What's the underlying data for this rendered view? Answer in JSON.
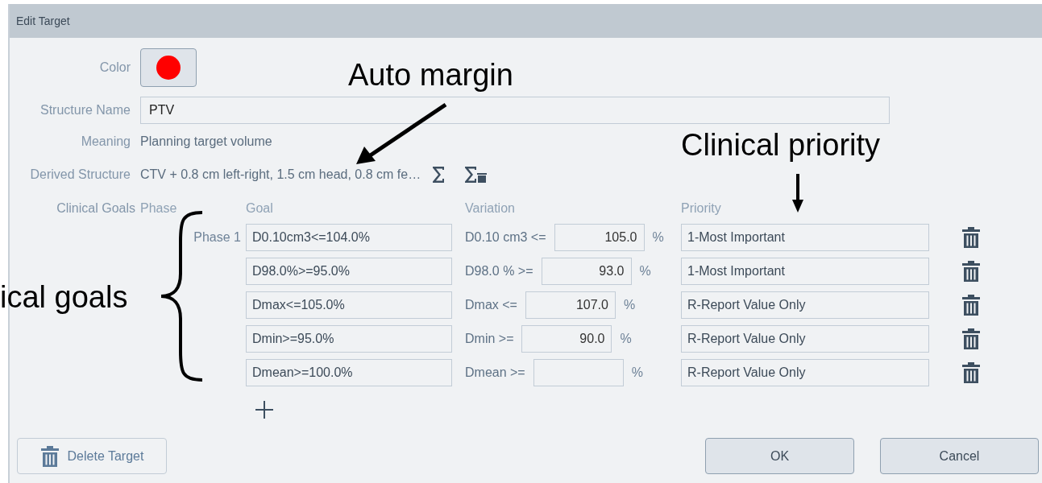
{
  "window": {
    "title": "Edit Target"
  },
  "form": {
    "color_label": "Color",
    "color": "#ff0000",
    "structure_name_label": "Structure Name",
    "structure_name": "PTV",
    "meaning_label": "Meaning",
    "meaning": "Planning target volume",
    "derived_label": "Derived Structure",
    "derived": "CTV + 0.8 cm left-right, 1.5 cm head, 0.8 cm fe…"
  },
  "clinical_goals": {
    "label": "Clinical Goals",
    "columns": [
      "Phase",
      "Goal",
      "Variation",
      "Priority"
    ],
    "rows": [
      {
        "phase": "Phase 1",
        "goal": "D0.10cm3<=104.0%",
        "variation_label": "D0.10 cm3 <=",
        "variation": "105.0",
        "unit": "%",
        "priority": "1-Most Important"
      },
      {
        "goal": "D98.0%>=95.0%",
        "variation_label": "D98.0 % >=",
        "variation": "93.0",
        "unit": "%",
        "priority": "1-Most Important"
      },
      {
        "goal": "Dmax<=105.0%",
        "variation_label": "Dmax <=",
        "variation": "107.0",
        "unit": "%",
        "priority": "R-Report Value Only"
      },
      {
        "goal": "Dmin>=95.0%",
        "variation_label": "Dmin >=",
        "variation": "90.0",
        "unit": "%",
        "priority": "R-Report Value Only"
      },
      {
        "goal": "Dmean>=100.0%",
        "variation_label": "Dmean >=",
        "unit": "%",
        "priority": "R-Report Value Only"
      }
    ]
  },
  "buttons": {
    "delete": "Delete Target",
    "ok": "OK",
    "cancel": "Cancel"
  },
  "annotations": [
    {
      "kind": "arrow",
      "text": "Auto margin"
    },
    {
      "kind": "down",
      "text": "Clinical priority"
    },
    {
      "kind": "brace",
      "text": "ical goals"
    }
  ]
}
